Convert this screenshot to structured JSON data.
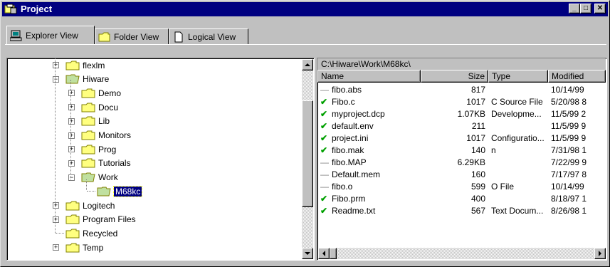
{
  "window": {
    "title": "Project",
    "icon": "project-icon"
  },
  "title_buttons": [
    {
      "name": "minimize-button",
      "glyph": "_"
    },
    {
      "name": "maximize-button",
      "glyph": "□"
    },
    {
      "name": "close-button",
      "glyph": "✕"
    }
  ],
  "tabs": [
    {
      "label": "Explorer View",
      "icon": "computer-icon",
      "active": true
    },
    {
      "label": "Folder View",
      "icon": "folder-icon",
      "active": false
    },
    {
      "label": "Logical View",
      "icon": "document-icon",
      "active": false
    }
  ],
  "tree": [
    {
      "label": "flexlm",
      "depth": 0,
      "expander": "+",
      "open": false
    },
    {
      "label": "Hiware",
      "depth": 0,
      "expander": "-",
      "open": true
    },
    {
      "label": "Demo",
      "depth": 1,
      "expander": "+",
      "open": false
    },
    {
      "label": "Docu",
      "depth": 1,
      "expander": "+",
      "open": false
    },
    {
      "label": "Lib",
      "depth": 1,
      "expander": "+",
      "open": false
    },
    {
      "label": "Monitors",
      "depth": 1,
      "expander": "+",
      "open": false
    },
    {
      "label": "Prog",
      "depth": 1,
      "expander": "+",
      "open": false
    },
    {
      "label": "Tutorials",
      "depth": 1,
      "expander": "+",
      "open": false
    },
    {
      "label": "Work",
      "depth": 1,
      "expander": "-",
      "open": true
    },
    {
      "label": "M68kc",
      "depth": 2,
      "expander": "",
      "open": true,
      "selected": true
    },
    {
      "label": "Logitech",
      "depth": 0,
      "expander": "+",
      "open": false
    },
    {
      "label": "Program Files",
      "depth": 0,
      "expander": "+",
      "open": false
    },
    {
      "label": "Recycled",
      "depth": 0,
      "expander": "",
      "open": false
    },
    {
      "label": "Temp",
      "depth": 0,
      "expander": "+",
      "open": false
    }
  ],
  "list": {
    "path": "C:\\Hiware\\Work\\M68kc\\",
    "columns": [
      "Name",
      "Size",
      "Type",
      "Modified"
    ],
    "rows": [
      {
        "mark": "dash",
        "name": "fibo.abs",
        "size": "817",
        "type": "",
        "modified": "10/14/99"
      },
      {
        "mark": "check",
        "name": "Fibo.c",
        "size": "1017",
        "type": "C Source File",
        "modified": "5/20/98 8"
      },
      {
        "mark": "check",
        "name": "myproject.dcp",
        "size": "1.07KB",
        "type": "Developme...",
        "modified": "11/5/99 2"
      },
      {
        "mark": "check",
        "name": "default.env",
        "size": "211",
        "type": "",
        "modified": "11/5/99 9"
      },
      {
        "mark": "check",
        "name": "project.ini",
        "size": "1017",
        "type": "Configuratio...",
        "modified": "11/5/99 9"
      },
      {
        "mark": "check",
        "name": "fibo.mak",
        "size": "140",
        "type": "n",
        "modified": "7/31/98 1"
      },
      {
        "mark": "dash",
        "name": "fibo.MAP",
        "size": "6.29KB",
        "type": "",
        "modified": "7/22/99 9"
      },
      {
        "mark": "dash",
        "name": "Default.mem",
        "size": "160",
        "type": "",
        "modified": "7/17/97 8"
      },
      {
        "mark": "dash",
        "name": "fibo.o",
        "size": "599",
        "type": "O File",
        "modified": "10/14/99"
      },
      {
        "mark": "check",
        "name": "Fibo.prm",
        "size": "400",
        "type": "",
        "modified": "8/18/97 1"
      },
      {
        "mark": "check",
        "name": "Readme.txt",
        "size": "567",
        "type": "Text Docum...",
        "modified": "8/26/98 1"
      }
    ]
  },
  "colors": {
    "titlebar": "#000080",
    "selection": "#000080",
    "check": "#00a000",
    "folder": "#ffff80",
    "open_folder_green": "#c0e0a0"
  }
}
